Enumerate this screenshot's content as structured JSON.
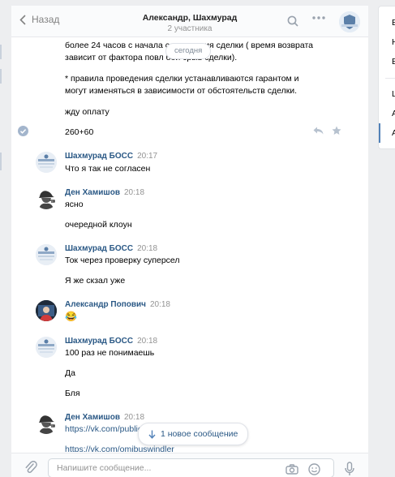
{
  "header": {
    "back_label": "Назад",
    "title": "Александр, Шахмурад",
    "subtitle": "2 участника"
  },
  "date_badge": "сегодня",
  "messages": {
    "top_lines": [
      "более 24 часов с начала совершения сделки ( время возврата",
      "зависит от фактора повл                              бой срыв сделки).",
      "* правила проведения сделки устанавливаются гарантом и",
      "могут изменяться в зависимости от обстоятельств сделки.",
      "жду оплату",
      "260+60"
    ],
    "groups": [
      {
        "author": "Шахмурад БОСС",
        "time": "20:17",
        "lines": [
          "Что я так не согласен"
        ]
      },
      {
        "author": "Ден Хамишов",
        "time": "20:18",
        "lines": [
          "ясно",
          "очередной клоун"
        ]
      },
      {
        "author": "Шахмурад БОСС",
        "time": "20:18",
        "lines": [
          "Ток через проверку суперсел",
          "Я же скзал уже"
        ]
      },
      {
        "author": "Александр Попович",
        "time": "20:18",
        "lines": [
          "😂"
        ]
      },
      {
        "author": "Шахмурад БОСС",
        "time": "20:18",
        "lines": [
          "100 раз не понимаешь",
          "Да",
          "Бля"
        ]
      },
      {
        "author": "Ден Хамишов",
        "time": "20:18",
        "lines": [
          "https://vk.com/public177605097",
          "https://vk.com/omibuswindler"
        ]
      }
    ]
  },
  "new_messages_label": "1 новое сообщение",
  "composer": {
    "placeholder": "Напишите сообщение..."
  },
  "right_panel": {
    "items": [
      "В",
      "Н",
      "В",
      "Ш",
      "А",
      "А"
    ]
  },
  "colors": {
    "link": "#2a5885",
    "accent": "#5181b8",
    "muted": "#939393",
    "background": "#edeef0"
  }
}
